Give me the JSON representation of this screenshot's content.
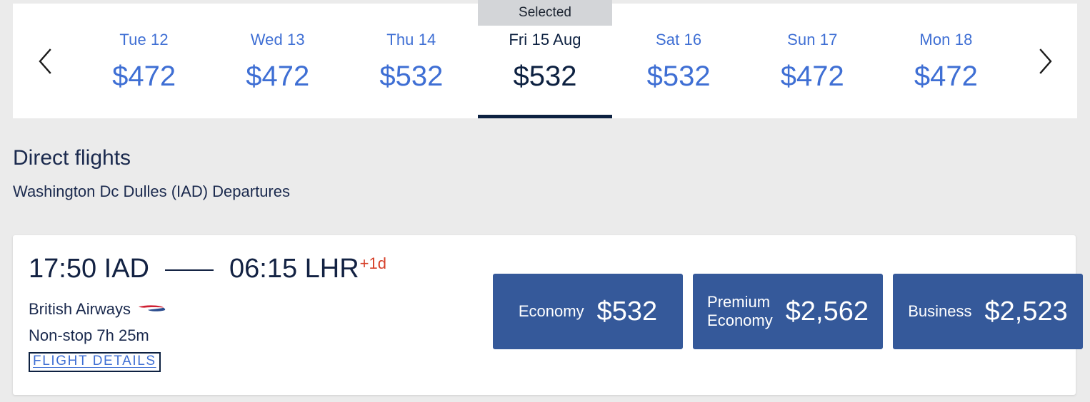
{
  "colors": {
    "page_background": "#ebebeb",
    "card_background": "#ffffff",
    "link_blue": "#3f6fd4",
    "navy": "#132243",
    "fare_button_blue": "#35599a",
    "selected_badge_gray": "#d3d5d8",
    "plus_day_red": "#d6402a"
  },
  "date_strip": {
    "prev_arrow": "chevron-left-icon",
    "next_arrow": "chevron-right-icon",
    "selected_badge_label": "Selected",
    "days": [
      {
        "day": "Tue 12",
        "price": "$472",
        "selected": false
      },
      {
        "day": "Wed 13",
        "price": "$472",
        "selected": false
      },
      {
        "day": "Thu 14",
        "price": "$532",
        "selected": false
      },
      {
        "day": "Fri 15 Aug",
        "price": "$532",
        "selected": true
      },
      {
        "day": "Sat 16",
        "price": "$532",
        "selected": false
      },
      {
        "day": "Sun 17",
        "price": "$472",
        "selected": false
      },
      {
        "day": "Mon 18",
        "price": "$472",
        "selected": false
      }
    ]
  },
  "section": {
    "title": "Direct flights",
    "subtitle": "Washington Dc Dulles (IAD) Departures"
  },
  "flight": {
    "departure": "17:50 IAD",
    "arrival": "06:15 LHR",
    "day_offset": "+1d",
    "airline": "British Airways",
    "airline_logo": "british-airways-speedmarque-icon",
    "stops": "Non-stop  7h 25m",
    "details_link": "FLIGHT DETAILS",
    "fares": [
      {
        "cabin": "Economy",
        "price": "$532"
      },
      {
        "cabin": "Premium\nEconomy",
        "price": "$2,562"
      },
      {
        "cabin": "Business",
        "price": "$2,523"
      }
    ]
  }
}
